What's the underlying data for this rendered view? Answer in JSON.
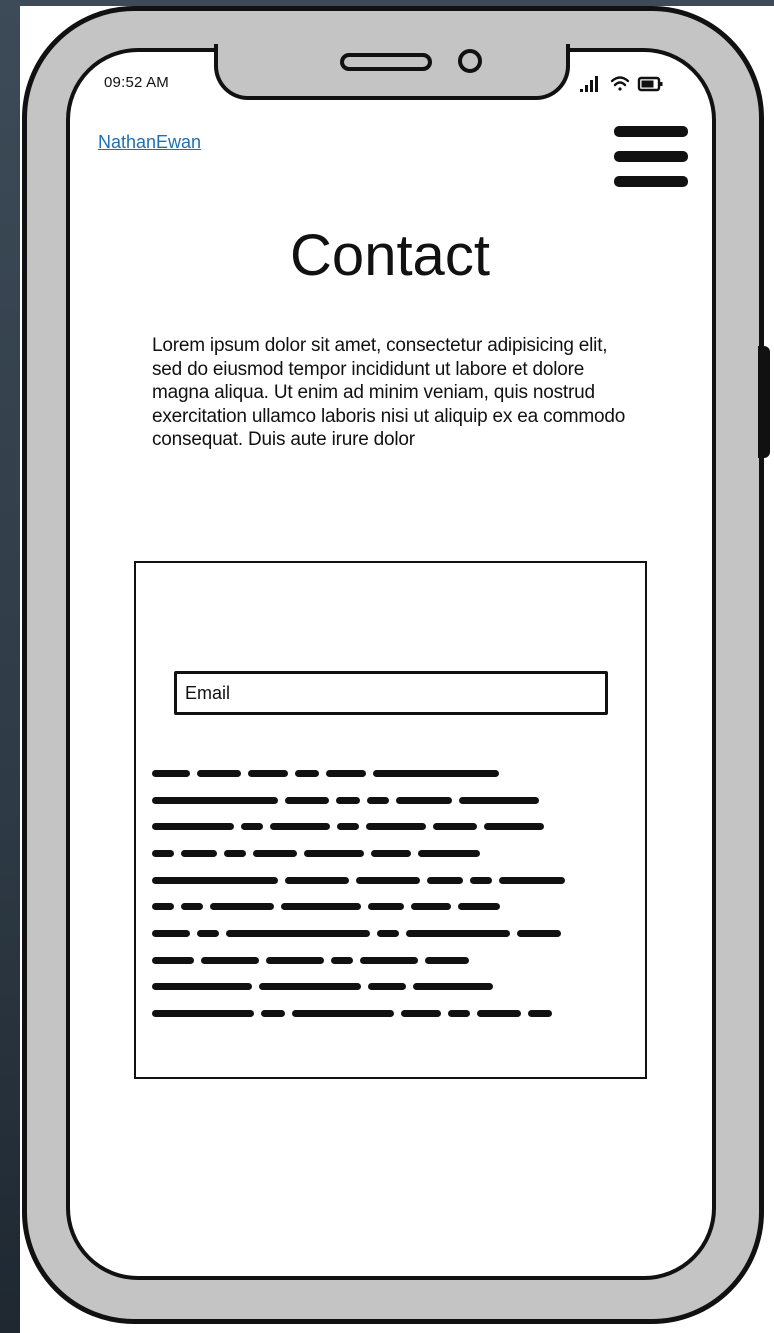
{
  "status_bar": {
    "time": "09:52 AM",
    "icons": [
      "signal-icon",
      "wifi-icon",
      "battery-icon"
    ]
  },
  "header": {
    "brand": "NathanEwan",
    "menu_icon": "hamburger-menu-icon"
  },
  "main": {
    "title": "Contact",
    "intro": "Lorem ipsum dolor sit amet, consectetur adipisicing elit, sed do eiusmod tempor incididunt ut labore et dolore magna aliqua. Ut enim ad minim veniam, quis nostrud exercitation ullamco laboris nisi ut aliquip ex ea commodo consequat. Duis aute irure dolor",
    "form": {
      "email_placeholder": "Email",
      "email_value": ""
    }
  },
  "colors": {
    "link": "#1f6fb3",
    "ink": "#111111",
    "frame": "#c4c4c4"
  }
}
